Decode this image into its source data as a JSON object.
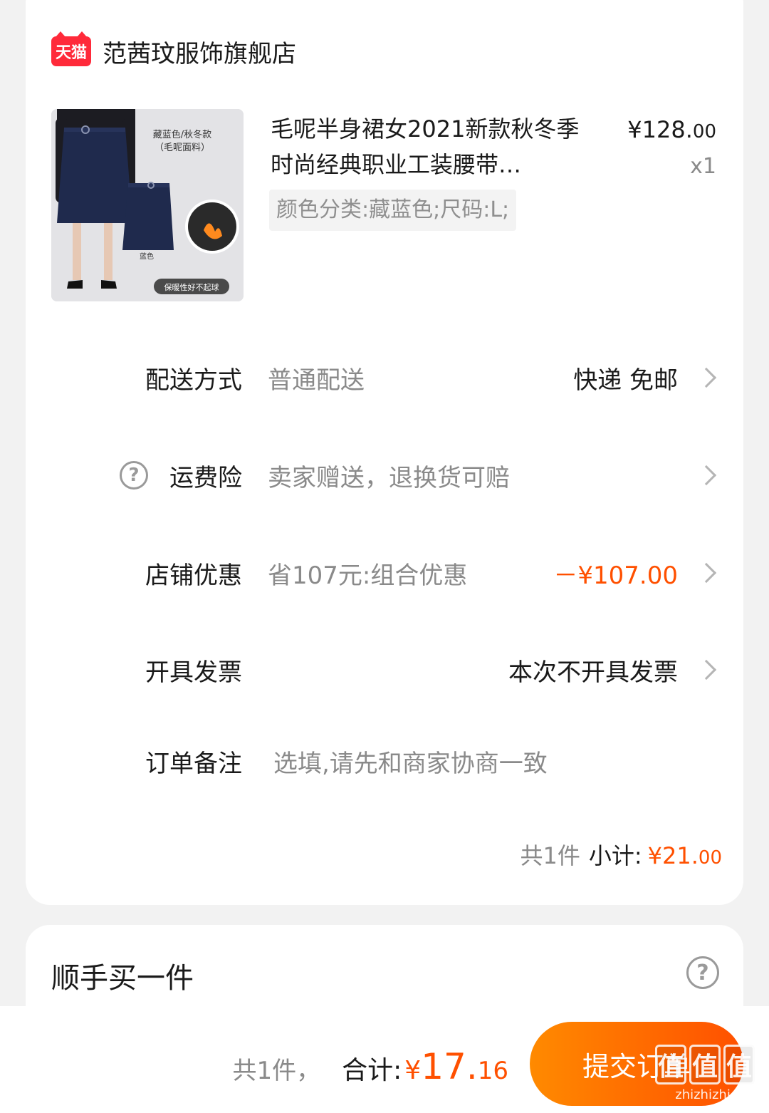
{
  "store": {
    "logo_text": "天猫",
    "name": "范茜玟服饰旗舰店"
  },
  "product": {
    "image_text": {
      "color_line1": "藏蓝色/秋冬款",
      "color_line2": "（毛呢面料）",
      "swatch_label": "蓝色",
      "badge": "保暖性好不起球"
    },
    "title": "毛呢半身裙女2021新款秋冬季时尚经典职业工装腰带…",
    "price_int": "¥128.",
    "price_dec": "00",
    "quantity": "x1",
    "sku": "颜色分类:藏蓝色;尺码:L;"
  },
  "rows": {
    "delivery": {
      "label": "配送方式",
      "desc": "普通配送",
      "value": "快递 免邮"
    },
    "insurance": {
      "label": "运费险",
      "desc": "卖家赠送，退换货可赔",
      "icon": "help-circle-icon"
    },
    "discount": {
      "label": "店铺优惠",
      "desc": "省107元:组合优惠",
      "value": "－¥107.00"
    },
    "invoice": {
      "label": "开具发票",
      "value": "本次不开具发票"
    },
    "note": {
      "label": "订单备注",
      "placeholder": "选填,请先和商家协商一致"
    }
  },
  "subtotal": {
    "count": "共1件",
    "label": "小计:",
    "amount_int": "¥21.",
    "amount_dec": "00"
  },
  "extra": {
    "title": "顺手买一件"
  },
  "footer": {
    "count": "共1件，",
    "label": "合计:",
    "yen": "¥",
    "total_int": "17.",
    "total_dec": "16",
    "submit_label": "提交订单"
  },
  "watermark": {
    "chars": [
      "值",
      "值",
      "值"
    ],
    "url": "zhizhizhi.com"
  },
  "colors": {
    "accent": "#ff5000",
    "tmall_red": "#ff2a3a",
    "button_start": "#ff8a00",
    "button_end": "#ff5000"
  }
}
